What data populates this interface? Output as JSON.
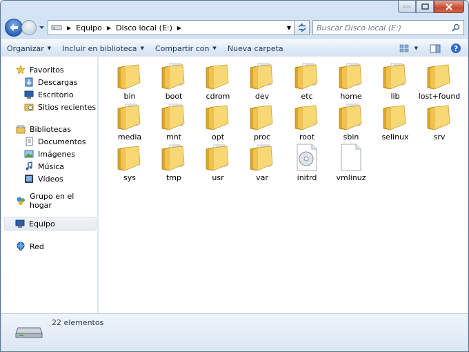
{
  "address": {
    "crumbs": [
      "Equipo",
      "Disco local (E:)"
    ]
  },
  "search": {
    "placeholder": "Buscar Disco local (E:)"
  },
  "toolbar": {
    "organize": "Organizar",
    "include": "Incluir en biblioteca",
    "share": "Compartir con",
    "new_folder": "Nueva carpeta"
  },
  "sidebar": {
    "favorites": {
      "label": "Favoritos",
      "items": [
        "Descargas",
        "Escritorio",
        "Sitios recientes"
      ]
    },
    "libraries": {
      "label": "Bibliotecas",
      "items": [
        "Documentos",
        "Imágenes",
        "Música",
        "Vídeos"
      ]
    },
    "homegroup": "Grupo en el hogar",
    "computer": "Equipo",
    "network": "Red"
  },
  "files": [
    {
      "name": "bin",
      "type": "folder"
    },
    {
      "name": "boot",
      "type": "folder-docs"
    },
    {
      "name": "cdrom",
      "type": "folder"
    },
    {
      "name": "dev",
      "type": "folder-docs"
    },
    {
      "name": "etc",
      "type": "folder-docs"
    },
    {
      "name": "home",
      "type": "folder-docs"
    },
    {
      "name": "lib",
      "type": "folder-docs"
    },
    {
      "name": "lost+found",
      "type": "folder"
    },
    {
      "name": "media",
      "type": "folder-docs"
    },
    {
      "name": "mnt",
      "type": "folder-docs"
    },
    {
      "name": "opt",
      "type": "folder"
    },
    {
      "name": "proc",
      "type": "folder"
    },
    {
      "name": "root",
      "type": "folder"
    },
    {
      "name": "sbin",
      "type": "folder-docs"
    },
    {
      "name": "selinux",
      "type": "folder"
    },
    {
      "name": "srv",
      "type": "folder"
    },
    {
      "name": "sys",
      "type": "folder"
    },
    {
      "name": "tmp",
      "type": "folder-docs"
    },
    {
      "name": "usr",
      "type": "folder-docs"
    },
    {
      "name": "var",
      "type": "folder-docs"
    },
    {
      "name": "initrd",
      "type": "file-disc"
    },
    {
      "name": "vmlinuz",
      "type": "file-blank"
    }
  ],
  "status": {
    "count": "22 elementos"
  }
}
